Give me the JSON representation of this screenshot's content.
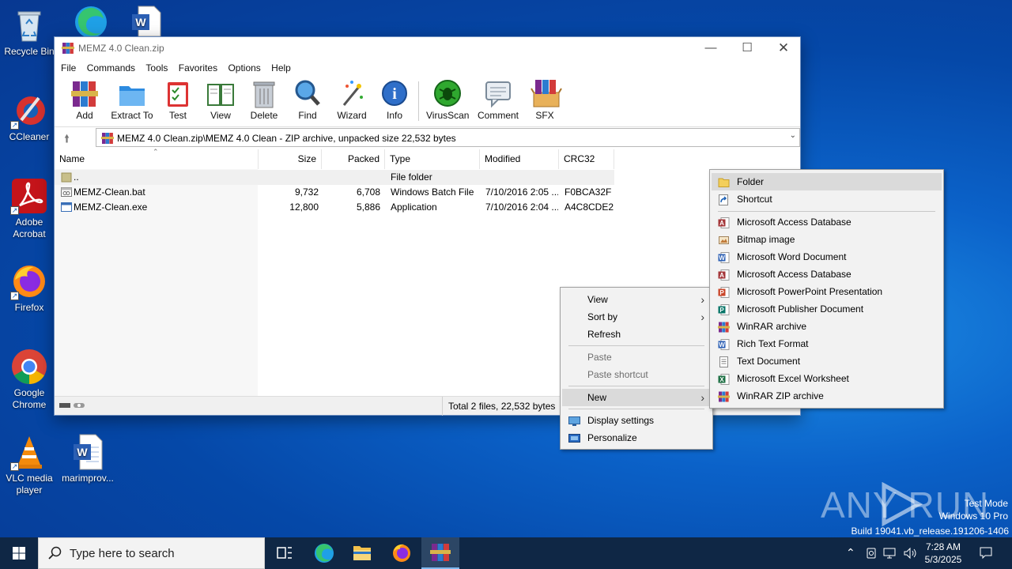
{
  "desktop": {
    "icons": [
      {
        "label": "Recycle Bin"
      },
      {
        "label": "CCleaner"
      },
      {
        "label": "Adobe\nAcrobat"
      },
      {
        "label": "Firefox"
      },
      {
        "label": "Google\nChrome"
      },
      {
        "label": "VLC media\nplayer"
      },
      {
        "label": "marimprov..."
      }
    ]
  },
  "winrar": {
    "title": "MEMZ 4.0 Clean.zip",
    "menu": [
      "File",
      "Commands",
      "Tools",
      "Favorites",
      "Options",
      "Help"
    ],
    "toolbar": [
      "Add",
      "Extract To",
      "Test",
      "View",
      "Delete",
      "Find",
      "Wizard",
      "Info",
      "VirusScan",
      "Comment",
      "SFX"
    ],
    "path": "MEMZ 4.0 Clean.zip\\MEMZ 4.0 Clean - ZIP archive, unpacked size 22,532 bytes",
    "columns": [
      "Name",
      "Size",
      "Packed",
      "Type",
      "Modified",
      "CRC32"
    ],
    "rows": [
      {
        "name": "..",
        "size": "",
        "packed": "",
        "type": "File folder",
        "modified": "",
        "crc": ""
      },
      {
        "name": "MEMZ-Clean.bat",
        "size": "9,732",
        "packed": "6,708",
        "type": "Windows Batch File",
        "modified": "7/10/2016 2:05 ...",
        "crc": "F0BCA32F"
      },
      {
        "name": "MEMZ-Clean.exe",
        "size": "12,800",
        "packed": "5,886",
        "type": "Application",
        "modified": "7/10/2016 2:04 ...",
        "crc": "A4C8CDE2"
      }
    ],
    "status_total": "Total 2 files, 22,532 bytes"
  },
  "context_menu": {
    "view": "View",
    "sort_by": "Sort by",
    "refresh": "Refresh",
    "paste": "Paste",
    "paste_shortcut": "Paste shortcut",
    "new": "New",
    "display_settings": "Display settings",
    "personalize": "Personalize"
  },
  "new_submenu": {
    "folder": "Folder",
    "shortcut": "Shortcut",
    "items": [
      {
        "label": "Microsoft Access Database",
        "icon": "access-icon"
      },
      {
        "label": "Bitmap image",
        "icon": "bitmap-icon"
      },
      {
        "label": "Microsoft Word Document",
        "icon": "word-icon"
      },
      {
        "label": "Microsoft Access Database",
        "icon": "access-icon"
      },
      {
        "label": "Microsoft PowerPoint Presentation",
        "icon": "powerpoint-icon"
      },
      {
        "label": "Microsoft Publisher Document",
        "icon": "publisher-icon"
      },
      {
        "label": "WinRAR archive",
        "icon": "winrar-icon"
      },
      {
        "label": "Rich Text Format",
        "icon": "rtf-icon"
      },
      {
        "label": "Text Document",
        "icon": "text-icon"
      },
      {
        "label": "Microsoft Excel Worksheet",
        "icon": "excel-icon"
      },
      {
        "label": "WinRAR ZIP archive",
        "icon": "winrar-icon"
      }
    ]
  },
  "taskbar": {
    "search_placeholder": "Type here to search",
    "time": "7:28 AM",
    "date": "5/3/2025"
  },
  "watermark": {
    "brand": "ANY RUN",
    "line1": "Test Mode",
    "line2": "Windows 10 Pro",
    "line3": "Build 19041.vb_release.191206-1406"
  },
  "colors": {
    "desktop": "#0b62c9",
    "taskbar": "#0f2745",
    "menu_bg": "#f2f2f2",
    "menu_highlight": "#dadada"
  }
}
